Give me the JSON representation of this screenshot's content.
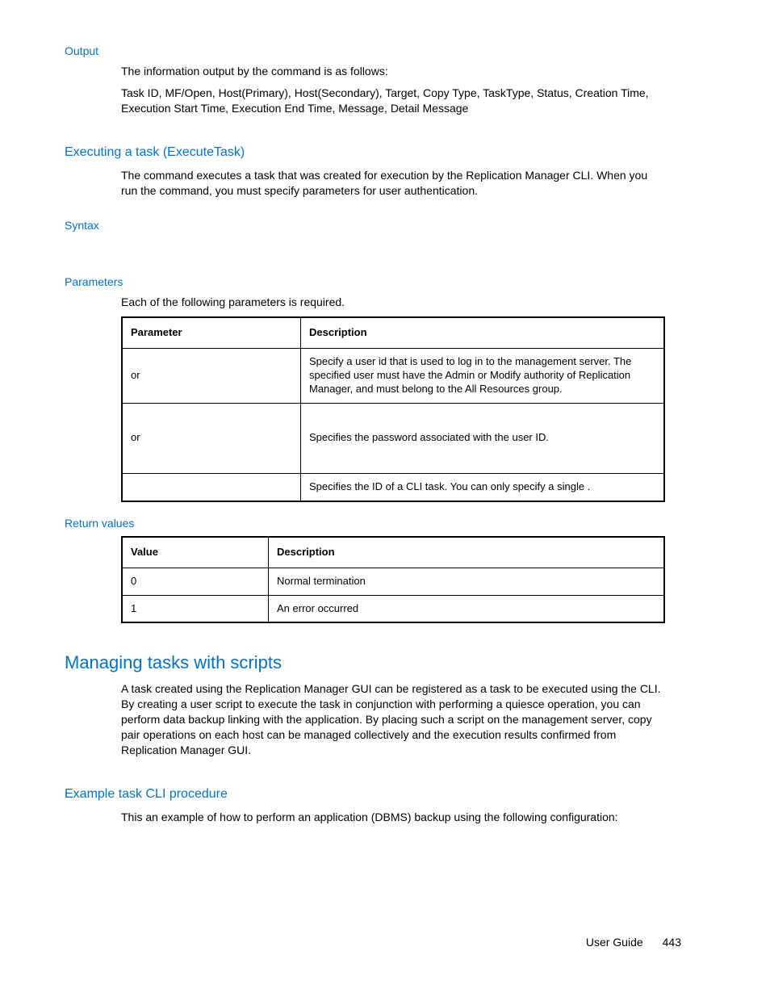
{
  "output": {
    "heading": "Output",
    "p1_a": "The information output by the ",
    "p1_cmd": "",
    "p1_b": " command is as follows:",
    "p2": "Task ID, MF/Open, Host(Primary), Host(Secondary), Target, Copy Type, TaskType, Status, Creation Time, Execution Start Time, Execution End Time, Message, Detail Message"
  },
  "exec": {
    "heading": "Executing a task (ExecuteTask)",
    "p_a": "The ",
    "p_cmd1": "",
    "p_b": " command executes a task that was created for execution by the Replication Manager CLI. When you run the ",
    "p_cmd2": "",
    "p_c": " command, you must specify parameters for user authentication."
  },
  "syntax": {
    "heading": "Syntax"
  },
  "params": {
    "heading": "Parameters",
    "intro": "Each of the following parameters is required.",
    "th1": "Parameter",
    "th2": "Description",
    "rows": [
      {
        "param": "or",
        "desc": "Specify a user id that is used to log in to the management server. The specified user must have the Admin or Modify authority of Replication Manager, and must belong to the All Resources group."
      },
      {
        "param": "or",
        "desc": "Specifies the password associated with the user ID."
      },
      {
        "param": "",
        "desc_a": "Specifies the ID of a CLI task. You can only specify a single ",
        "desc_code": "",
        "desc_b": "."
      }
    ]
  },
  "ret": {
    "heading": "Return values",
    "th1": "Value",
    "th2": "Description",
    "rows": [
      {
        "value": "0",
        "desc": "Normal termination"
      },
      {
        "value": "1",
        "desc": "An error occurred"
      }
    ]
  },
  "scripts": {
    "heading": "Managing tasks with scripts",
    "p1": "A task created using the Replication Manager GUI can be registered as a task to be executed using the CLI. By creating a user script to execute the task in conjunction with performing a quiesce operation, you can perform data backup linking with the application. By placing such a script on the management server, copy pair operations on each host can be managed collectively and the execution results confirmed from Replication Manager GUI."
  },
  "example": {
    "heading": "Example task CLI procedure",
    "p1": "This an example of how to perform an application (DBMS) backup using the following configuration:"
  },
  "footer": {
    "label": "User Guide",
    "page": "443"
  }
}
